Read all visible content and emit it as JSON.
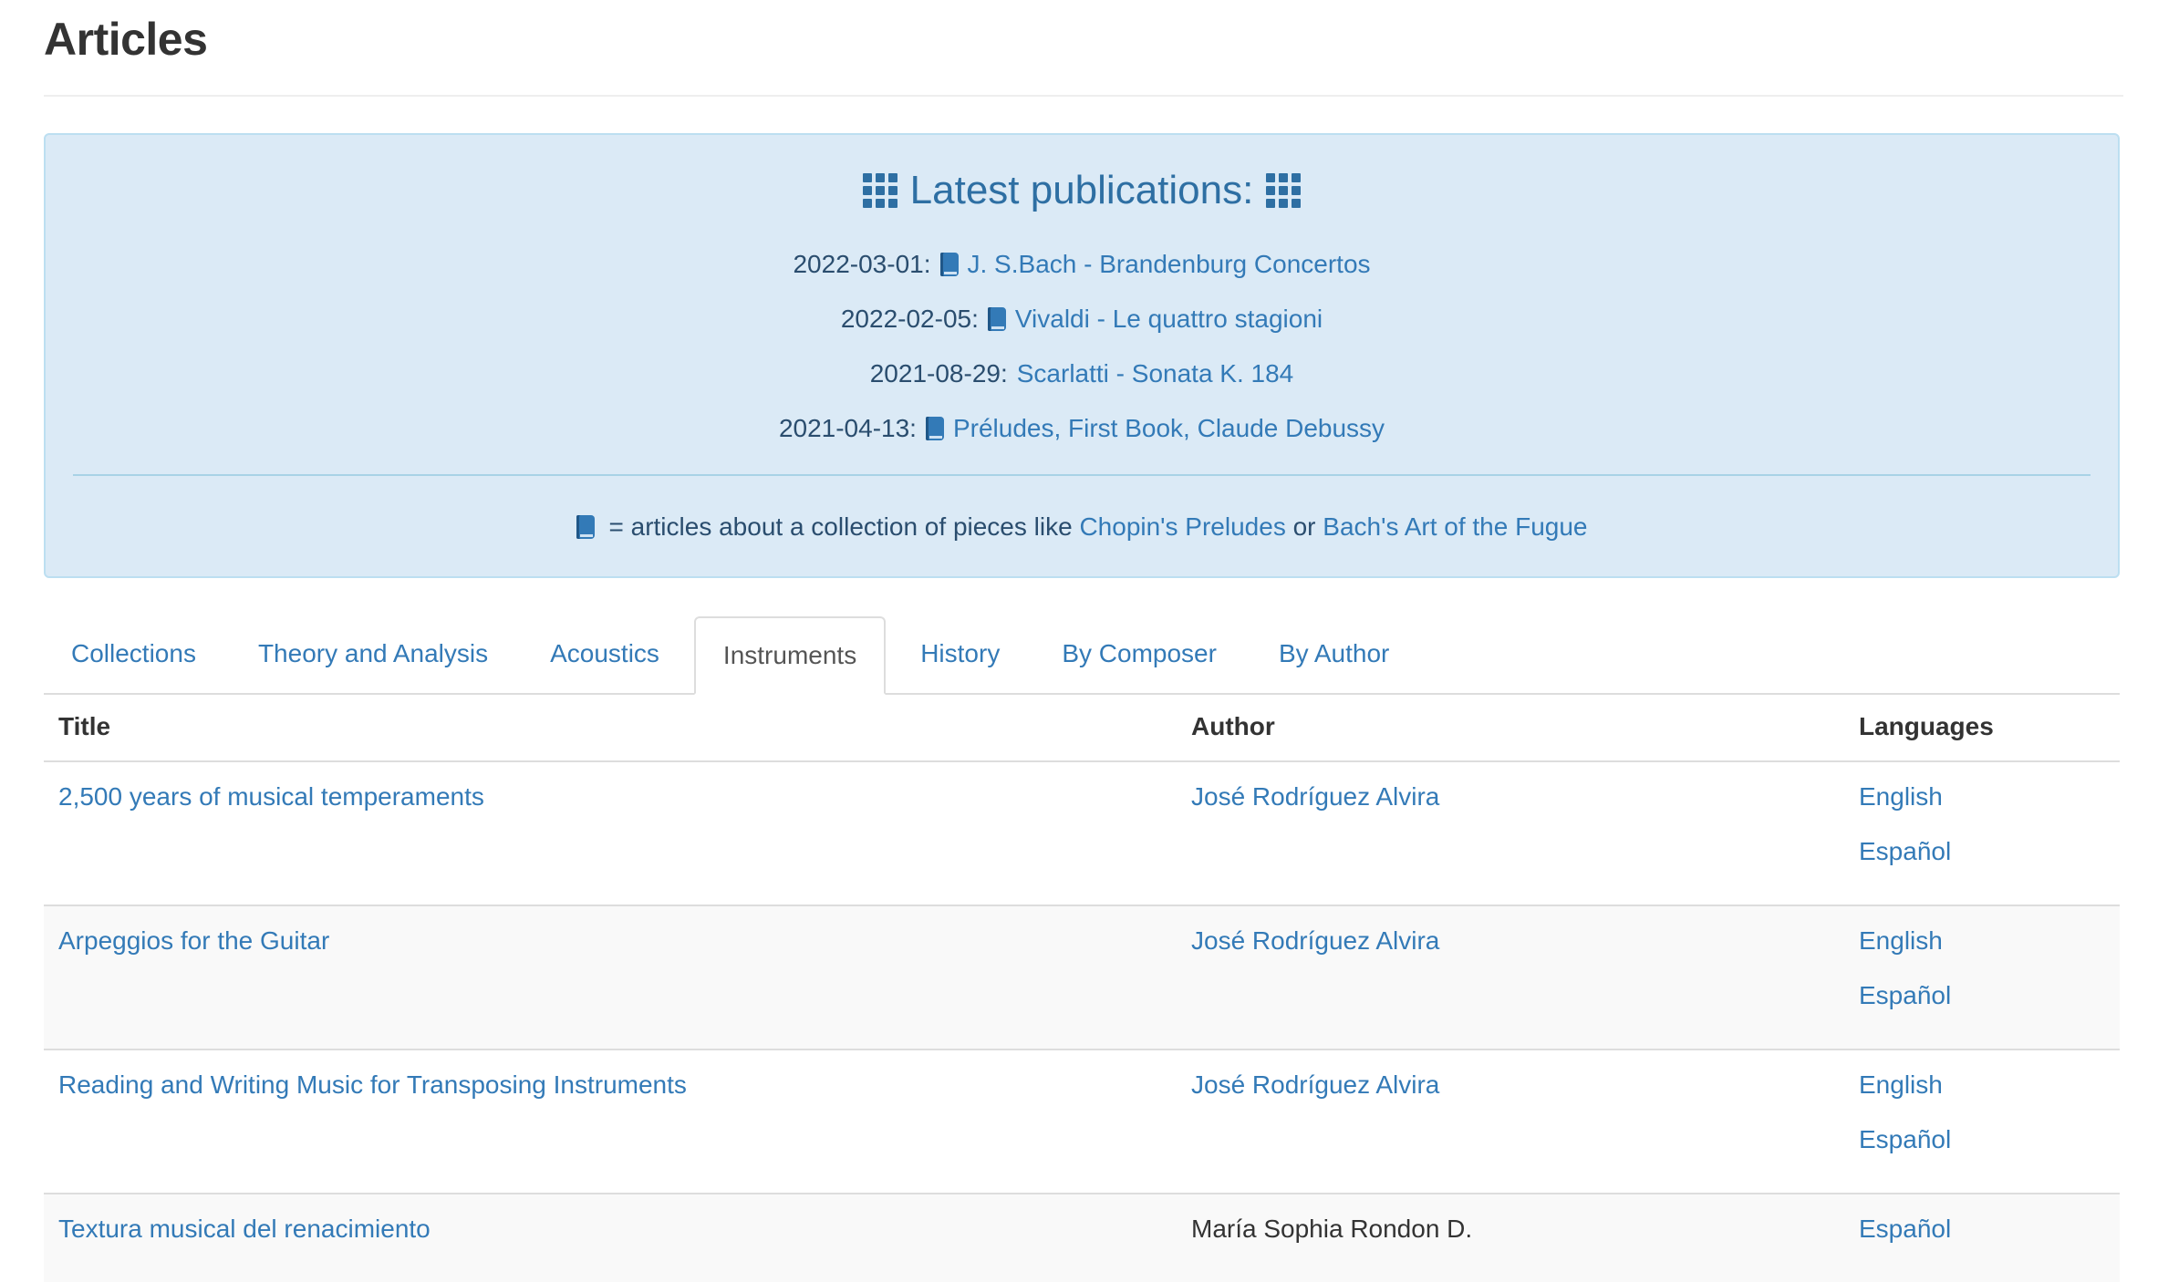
{
  "page": {
    "title": "Articles"
  },
  "latest": {
    "heading": "Latest publications:",
    "items": [
      {
        "date": "2022-03-01:",
        "title": "J. S.Bach - Brandenburg Concertos",
        "collection": true
      },
      {
        "date": "2022-02-05:",
        "title": "Vivaldi - Le quattro stagioni",
        "collection": true
      },
      {
        "date": "2021-08-29:",
        "title": "Scarlatti - Sonata K. 184",
        "collection": false
      },
      {
        "date": "2021-04-13:",
        "title": "Préludes, First Book, Claude Debussy",
        "collection": true
      }
    ],
    "legend": {
      "text": "= articles about a collection of pieces like",
      "link1": "Chopin's Preludes",
      "or": "or",
      "link2": "Bach's Art of the Fugue"
    }
  },
  "tabs": [
    {
      "label": "Collections",
      "active": false
    },
    {
      "label": "Theory and Analysis",
      "active": false
    },
    {
      "label": "Acoustics",
      "active": false
    },
    {
      "label": "Instruments",
      "active": true
    },
    {
      "label": "History",
      "active": false
    },
    {
      "label": "By Composer",
      "active": false
    },
    {
      "label": "By Author",
      "active": false
    }
  ],
  "table": {
    "headers": {
      "title": "Title",
      "author": "Author",
      "languages": "Languages"
    },
    "rows": [
      {
        "title": "2,500 years of musical temperaments",
        "author": "José Rodríguez Alvira",
        "languages": [
          "English",
          "Español"
        ]
      },
      {
        "title": "Arpeggios for the Guitar",
        "author": "José Rodríguez Alvira",
        "languages": [
          "English",
          "Español"
        ]
      },
      {
        "title": "Reading and Writing Music for Transposing Instruments",
        "author": "José Rodríguez Alvira",
        "languages": [
          "English",
          "Español"
        ]
      },
      {
        "title": "Textura musical del renacimiento",
        "author": "María Sophia Rondon D.",
        "languages": [
          "Español"
        ]
      }
    ]
  },
  "colors": {
    "link": "#337ab7",
    "well_bg": "#dbeaf6",
    "well_border": "#bcdff1"
  },
  "icons": {
    "heading": "grid-icon",
    "collection": "book-icon"
  }
}
